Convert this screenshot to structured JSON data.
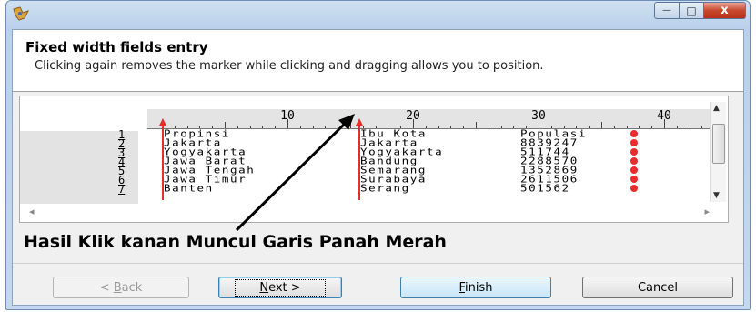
{
  "window": {
    "close_glyph": "x",
    "minimize_glyph": "—",
    "maximize_glyph": "□"
  },
  "header": {
    "title": "Fixed width fields entry",
    "description": "Clicking again removes the marker while clicking and dragging allows you to position."
  },
  "ruler": {
    "labels": [
      "10",
      "20",
      "30",
      "40"
    ]
  },
  "table": {
    "line_numbers": [
      "1",
      "2",
      "3",
      "4",
      "5",
      "6",
      "7"
    ],
    "col1": [
      "Propinsi",
      "Jakarta",
      "Yogyakarta",
      "Jawa Barat",
      "Jawa Tengah",
      "Jawa Timur",
      "Banten"
    ],
    "col2": [
      "Ibu Kota",
      "Jakarta",
      "Yogyakarta",
      "Bandung",
      "Semarang",
      "Surabaya",
      "Serang"
    ],
    "col3": [
      "Populasi",
      "8839247",
      "511744",
      "2288570",
      "1352869",
      "2611506",
      "501562"
    ]
  },
  "caption": "Hasil Klik kanan Muncul Garis Panah Merah",
  "buttons": {
    "back": {
      "label": "< Back",
      "disabled": true
    },
    "next": {
      "label": "Next >"
    },
    "finish": {
      "label": "Finish"
    },
    "cancel": {
      "label": "Cancel"
    }
  },
  "colors": {
    "marker": "#e0322c",
    "annotation_arrow": "#000000"
  }
}
